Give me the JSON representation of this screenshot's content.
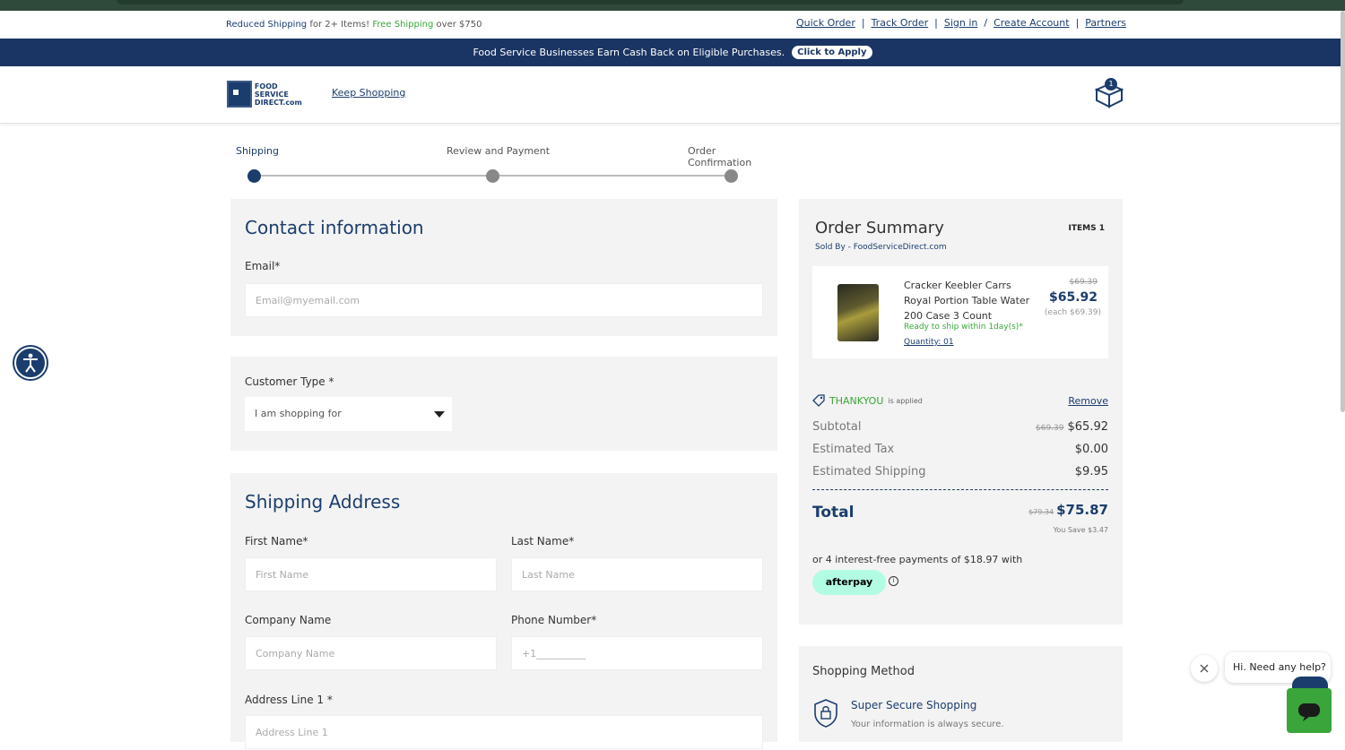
{
  "utility": {
    "reduced": "Reduced Shipping",
    "for_items": " for 2+ Items! ",
    "free": "Free Shipping",
    "over": " over $750",
    "quick_order": "Quick Order",
    "track_order": "Track Order",
    "sign_in": "Sign in",
    "slash": "/",
    "create_account": "Create Account",
    "partners": "Partners"
  },
  "banner": {
    "text": "Food Service Businesses Earn Cash Back on Eligible Purchases.",
    "button": "Click to Apply"
  },
  "header": {
    "logo_line1": "FOOD SERVICE",
    "logo_line2": "DIRECT.com",
    "keep_shopping": "Keep Shopping",
    "cart_count": "1"
  },
  "steps": [
    {
      "label": "Shipping",
      "active": true
    },
    {
      "label": "Review and Payment",
      "active": false
    },
    {
      "label": "Order Confirmation",
      "active": false
    }
  ],
  "contact": {
    "title": "Contact information",
    "email_label": "Email*",
    "email_placeholder": "Email@myemail.com"
  },
  "customer": {
    "label": "Customer Type *",
    "selected": "I am shopping for"
  },
  "shipping": {
    "title": "Shipping Address",
    "first_label": "First Name*",
    "first_placeholder": "First Name",
    "last_label": "Last Name*",
    "last_placeholder": "Last Name",
    "company_label": "Company Name",
    "company_placeholder": "Company Name",
    "phone_label": "Phone Number*",
    "phone_placeholder": "+1__________",
    "address_label": "Address Line 1 *",
    "address_placeholder": "Address Line 1"
  },
  "summary": {
    "title": "Order Summary",
    "items": "ITEMS 1",
    "sold_by": "Sold By - FoodServiceDirect.com",
    "product": {
      "name": "Cracker Keebler Carrs Royal Portion Table Water 200 Case 3 Count",
      "ready": "Ready to ship within 1day(s)*",
      "quantity": "Quantity: 01",
      "old_price": "$69.39",
      "price": "$65.92",
      "each": "(each $69.39)"
    },
    "coupon": "THANKYOU",
    "coupon_applied": "is applied",
    "remove": "Remove",
    "subtotal_label": "Subtotal",
    "subtotal_old": "$69.39",
    "subtotal": "$65.92",
    "tax_label": "Estimated Tax",
    "tax": "$0.00",
    "ship_label": "Estimated Shipping",
    "ship": "$9.95",
    "total_label": "Total",
    "total_old": "$79.34",
    "total": "$75.87",
    "you_save": "You Save $3.47",
    "afterpay_text": "or 4 interest-free payments of $18.97 with",
    "afterpay_logo": "afterpay",
    "info": "i"
  },
  "method": {
    "title": "Shopping Method",
    "secure": "Super Secure Shopping",
    "secure_sub": "Your information is always secure."
  },
  "chat": {
    "message": "Hi. Need any help?"
  },
  "colors": {
    "navy": "#1b3d6d",
    "green": "#3aa53a",
    "panel": "#f3f3f3"
  }
}
